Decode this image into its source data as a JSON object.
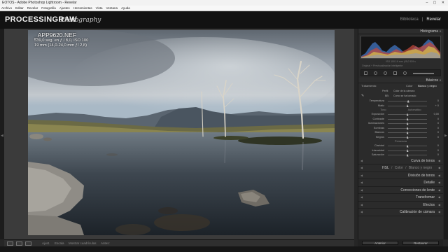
{
  "window": {
    "title": "EOTOS - Adobe Photoshop Lightroom - Revelar",
    "controls": "– ▢ ✕"
  },
  "menu": [
    "Archivo",
    "Editar",
    "Revelar",
    "Fotografía",
    "Ajustes",
    "Herramientas",
    "Vista",
    "Ventana",
    "Ayuda"
  ],
  "identity": {
    "logo_main": "PROCESSING",
    "logo_raw": "RAW",
    "logo_script": "Photography"
  },
  "modules": {
    "library": "Biblioteca",
    "separator": "|",
    "develop": "Revelar"
  },
  "photo_info": {
    "filename": "_APP9620.NEF",
    "exposure": "539,0 seg. en ƒ / 8,0, ISO 100",
    "lens": "19 mm (14,0-24,0 mm ƒ/ 2,8)"
  },
  "toolbar": {
    "labels": [
      "Ajust.",
      "Escala",
      "Mostrar cuadrículas",
      "Antes:"
    ]
  },
  "panel": {
    "histogram_title": "Histograma",
    "histogram_info": "ISO 100   19 mm   ƒ/8,0   539 s",
    "histogram_check": "Original + Previsualización inteligente",
    "basic_title": "Básicos",
    "treatment_label": "Tratamiento:",
    "treatment_color": "Color",
    "treatment_bw": "Blanco y negro",
    "profile_label": "Perfil:",
    "profile_value": "Color de la cámara",
    "wb_label": "BB:",
    "wb_value": "Como se ha tomado",
    "wb_rows": [
      {
        "label": "Temperatura",
        "value": "0",
        "pos": 0.52
      },
      {
        "label": "Matiz",
        "value": "+ 0",
        "pos": 0.5
      }
    ],
    "tone_title": "Tono",
    "tone_auto": "Automático",
    "tone_rows": [
      {
        "label": "Exposición",
        "value": "0,00",
        "pos": 0.5
      },
      {
        "label": "Contraste",
        "value": "0",
        "pos": 0.5
      },
      {
        "label": "Iluminaciones",
        "value": "0",
        "pos": 0.5
      },
      {
        "label": "Sombras",
        "value": "0",
        "pos": 0.5
      },
      {
        "label": "Blancos",
        "value": "0",
        "pos": 0.5
      },
      {
        "label": "Negros",
        "value": "0",
        "pos": 0.5
      }
    ],
    "presence_title": "Presencia",
    "presence_rows": [
      {
        "label": "Claridad",
        "value": "0",
        "pos": 0.5
      },
      {
        "label": "Intensidad",
        "value": "0",
        "pos": 0.5
      },
      {
        "label": "Saturación",
        "value": "0",
        "pos": 0.5
      }
    ],
    "tone_curve": "Curva de tonos",
    "hsl_tabs": [
      "HSL",
      "/",
      "Color",
      "/",
      "Blanco y negro"
    ],
    "collapsed": [
      "División de tonos",
      "Detalle",
      "Correcciones de lente",
      "Transformar",
      "Efectos",
      "Calibración de cámara"
    ],
    "btn_previous": "Anterior",
    "btn_reset": "Restaurar"
  },
  "colors": {
    "background": "#262626",
    "panel": "#2b2b2b",
    "header": "#121212",
    "accent_text": "#e8e8e8"
  }
}
